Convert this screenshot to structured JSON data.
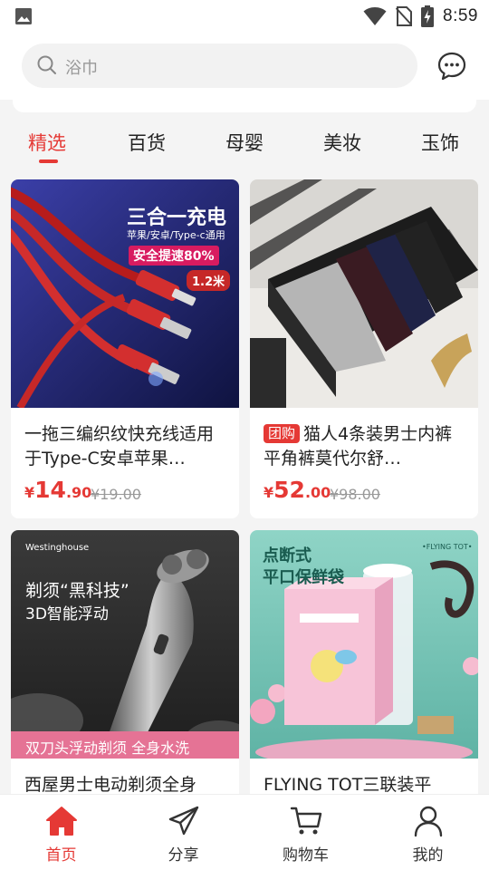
{
  "status_bar": {
    "time": "8:59"
  },
  "search": {
    "placeholder": "浴巾"
  },
  "tabs": [
    {
      "label": "精选",
      "active": true
    },
    {
      "label": "百货"
    },
    {
      "label": "母婴"
    },
    {
      "label": "美妆"
    },
    {
      "label": "玉饰"
    }
  ],
  "products": [
    {
      "title": "一拖三编织纹快充线适用于Type-C安卓苹果…",
      "badge": "",
      "price_symbol": "¥",
      "price_int": "14",
      "price_dec": ".90",
      "original_price": "¥19.00",
      "image_text": {
        "headline": "三合一充电",
        "subline": "苹果/安卓/Type-c通用",
        "tag": "安全提速80%",
        "length": "1.2米"
      }
    },
    {
      "title": "猫人4条装男士内裤平角裤莫代尔舒…",
      "badge": "团购",
      "price_symbol": "¥",
      "price_int": "52",
      "price_dec": ".00",
      "original_price": "¥98.00"
    },
    {
      "title": "西屋男士电动剃须全身",
      "image_text": {
        "brand": "Westinghouse",
        "line1": "剃须“黑科技”",
        "line2": "3D智能浮动",
        "footer": "双刀头浮动剃须  全身水洗"
      }
    },
    {
      "title": "FLYING TOT三联装平",
      "image_text": {
        "line1": "点断式",
        "line2": "平口保鲜袋",
        "brand": "•FLYING TOT•"
      }
    }
  ],
  "bottom_nav": [
    {
      "label": "首页",
      "icon": "home-icon",
      "active": true
    },
    {
      "label": "分享",
      "icon": "share-icon"
    },
    {
      "label": "购物车",
      "icon": "cart-icon"
    },
    {
      "label": "我的",
      "icon": "profile-icon"
    }
  ],
  "colors": {
    "accent": "#e53935",
    "background": "#f4f4f4"
  }
}
